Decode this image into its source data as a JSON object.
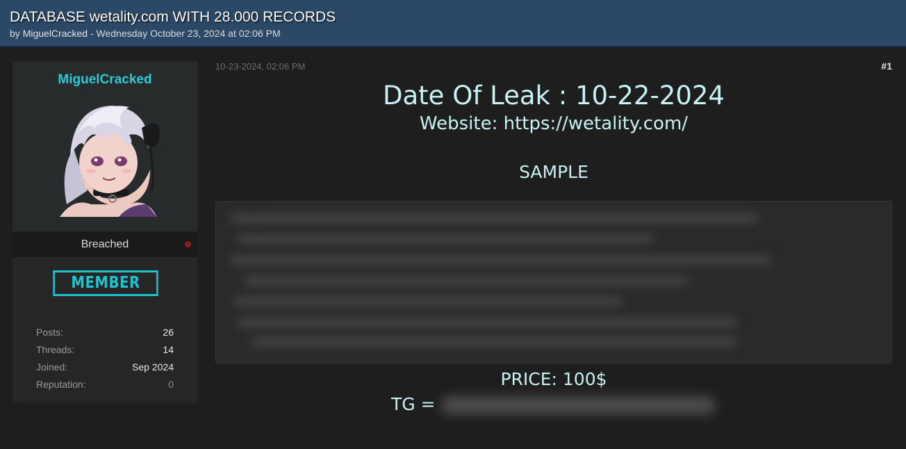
{
  "thread": {
    "title": "DATABASE wetality.com WITH 28.000 RECORDS",
    "by_prefix": "by ",
    "author": "MiguelCracked",
    "sep": " - ",
    "datetime": "Wednesday October 23, 2024 at 02:06 PM"
  },
  "user": {
    "name": "MiguelCracked",
    "rank": "Breached",
    "badge": "MEMBER",
    "stats": [
      {
        "label": "Posts:",
        "value": "26"
      },
      {
        "label": "Threads:",
        "value": "14"
      },
      {
        "label": "Joined:",
        "value": "Sep 2024"
      },
      {
        "label": "Reputation:",
        "value": "0"
      }
    ]
  },
  "post": {
    "date": "10-23-2024, 02:06 PM",
    "number": "#1",
    "leak_date": "Date Of Leak : 10-22-2024",
    "website": "Website: https://wetality.com/",
    "sample_label": "SAMPLE",
    "price": "PRICE: 100$",
    "tg_label": "TG ="
  },
  "colors": {
    "header_bg": "#2b4866",
    "accent_cyan": "#2ecad6",
    "post_text": "#c9f2f5",
    "page_bg": "#1e1e1e"
  }
}
